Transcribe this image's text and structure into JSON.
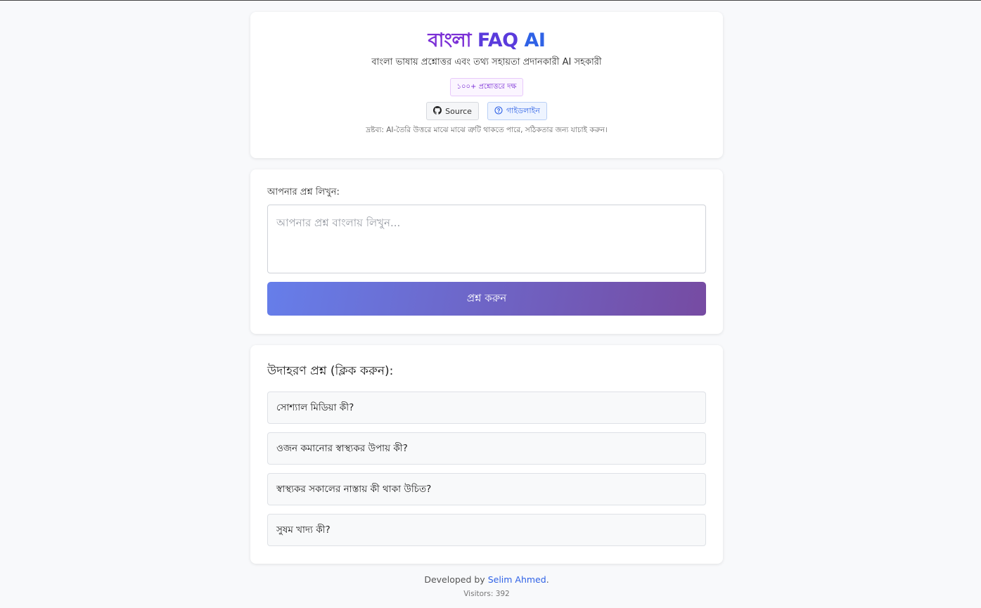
{
  "header": {
    "title_part1": "বাংলা",
    "title_part2": "FAQ",
    "title_part3": "AI",
    "subtitle": "বাংলা ভাষায় প্রশ্নোত্তর এবং তথ্য সহায়তা প্রদানকারী AI সহকারী",
    "badge": "১০০+ প্রশ্নোত্তরে দক্ষ",
    "source_label": "Source",
    "guide_label": "গাইডলাইন",
    "disclaimer": "দ্রষ্টব্য: AI-তৈরি উত্তরে মাঝে মাঝে ত্রুটি থাকতে পারে, সঠিকতার জন্য যাচাই করুন।"
  },
  "ask": {
    "label": "আপনার প্রশ্ন লিখুন:",
    "placeholder": "আপনার প্রশ্ন বাংলায় লিখুন...",
    "button": "প্রশ্ন করুন"
  },
  "examples": {
    "title": "উদাহরণ প্রশ্ন (ক্লিক করুন):",
    "items": [
      "সোশ্যাল মিডিয়া কী?",
      "ওজন কমানোর স্বাস্থ্যকর উপায় কী?",
      "স্বাস্থ্যকর সকালের নাস্তায় কী থাকা উচিত?",
      "সুষম খাদ্য কী?"
    ]
  },
  "footer": {
    "developed_by": "Developed by",
    "author": "Selim Ahmed",
    "period": ".",
    "visitors": "Visitors: 392"
  },
  "colors": {
    "accent_purple": "#7b2fd6",
    "accent_blue": "#2f62e6",
    "button_gradient_start": "#667eea",
    "button_gradient_end": "#764ba2"
  }
}
